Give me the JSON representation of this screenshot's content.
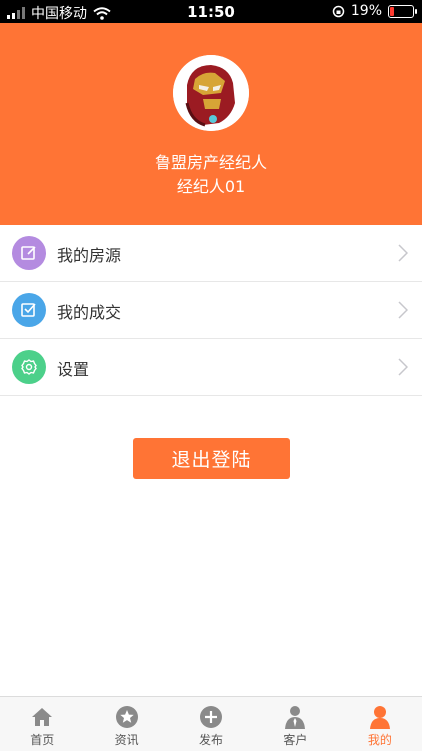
{
  "status_bar": {
    "carrier": "中国移动",
    "time": "11:50",
    "battery_percent": "19%",
    "battery_level": 0.19
  },
  "profile": {
    "company_name": "鲁盟房产经纪人",
    "role": "经纪人01"
  },
  "menu": {
    "items": [
      {
        "label": "我的房源",
        "icon": "edit-icon",
        "color": "#b48be0"
      },
      {
        "label": "我的成交",
        "icon": "checkbox-icon",
        "color": "#4aa6e8"
      },
      {
        "label": "设置",
        "icon": "gear-icon",
        "color": "#4cd08a"
      }
    ]
  },
  "logout_label": "退出登陆",
  "tabbar": {
    "items": [
      {
        "label": "首页",
        "icon": "home-icon",
        "active": false
      },
      {
        "label": "资讯",
        "icon": "star-circle-icon",
        "active": false
      },
      {
        "label": "发布",
        "icon": "plus-circle-icon",
        "active": false
      },
      {
        "label": "客户",
        "icon": "person-icon",
        "active": false
      },
      {
        "label": "我的",
        "icon": "user-icon",
        "active": true
      }
    ]
  },
  "colors": {
    "accent": "#ff7435",
    "tab_inactive_icon": "#8a8a8a"
  }
}
